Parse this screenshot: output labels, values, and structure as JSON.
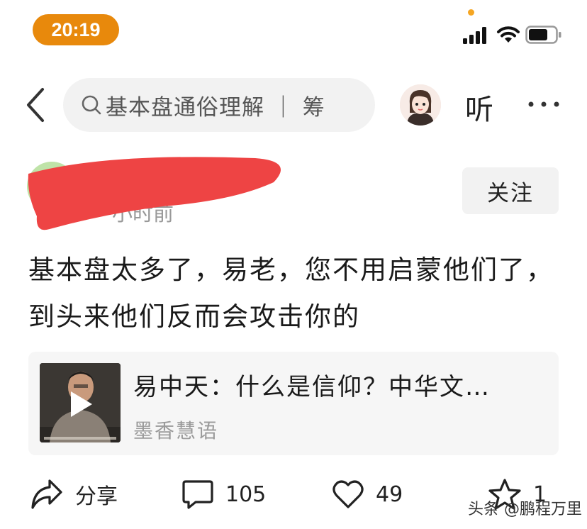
{
  "status_bar": {
    "time": "20:19"
  },
  "nav": {
    "search_text": "基本盘通俗理解 ｜ 筹",
    "listen_label": "听"
  },
  "post": {
    "time_ago": "小时前",
    "follow_label": "关注",
    "content": "基本盘太多了，易老，您不用启蒙他们了，到头来他们反而会攻击你的"
  },
  "linked_card": {
    "title": "易中天：什么是信仰？中华文…",
    "source": "墨香慧语"
  },
  "actions": {
    "share_label": "分享",
    "comment_count": "105",
    "like_count": "49",
    "favorite_count": "1"
  },
  "watermark": "头条 @鹏程万里",
  "colors": {
    "time_pill": "#e8890c",
    "redaction": "#ee4444"
  }
}
